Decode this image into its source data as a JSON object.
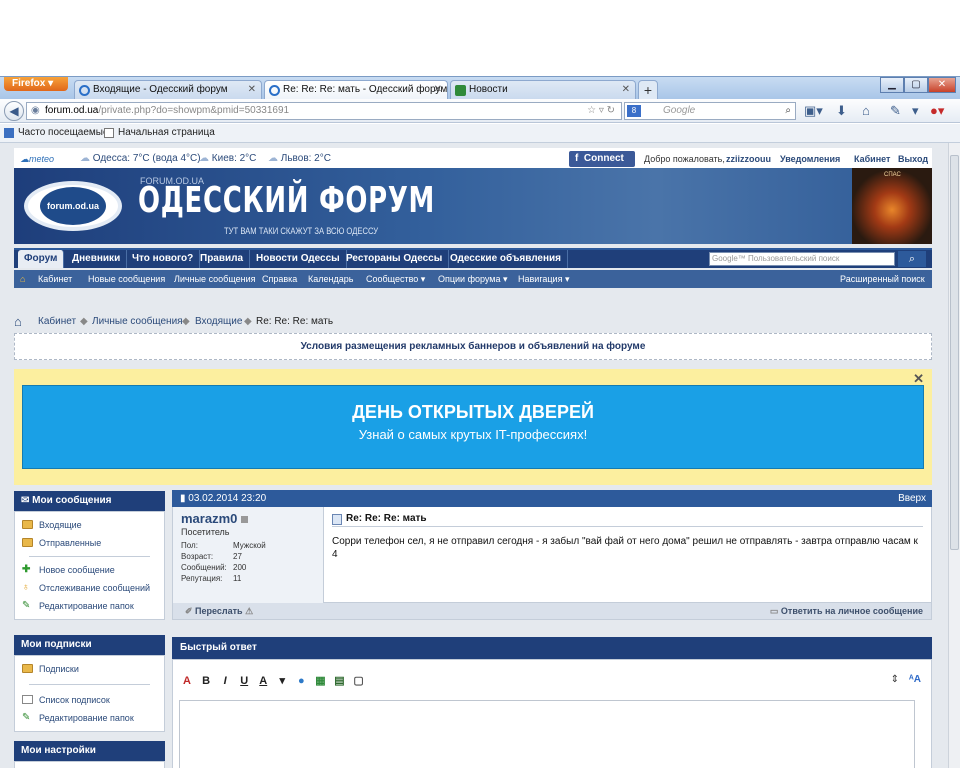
{
  "browser": {
    "app_button": "Firefox",
    "tabs": [
      {
        "title": "Входящие - Одесский форум",
        "active": false
      },
      {
        "title": "Re: Re: Re: мать - Одесский форум",
        "active": true
      },
      {
        "title": "Новости",
        "active": false
      }
    ],
    "new_tab": "+",
    "url_host": "forum.od.ua",
    "url_path": "/private.php?do=showpm&pmid=50331691",
    "search_placeholder": "Google",
    "bookmarks": [
      "Часто посещаемые",
      "Начальная страница"
    ]
  },
  "site": {
    "weather_brand": "meteo",
    "weather": [
      "Одесса: 7°С (вода 4°С)",
      "Киев: 2°С",
      "Львов: 2°С"
    ],
    "fb_connect": "Connect",
    "welcome": "Добро пожаловать,",
    "username": "zziizzoouu",
    "user_links": [
      "Уведомления",
      "Кабинет",
      "Выход"
    ],
    "header_small": "FORUM.OD.UA",
    "logo_text": "forum.od.ua",
    "title": "ОДЕССКИЙ ФОРУМ",
    "tagline": "ТУТ ВАМ ТАКИ СКАЖУТ ЗА ВСЮ ОДЕССУ",
    "art_label": "СПАС",
    "main_nav": [
      "Форум",
      "Дневники",
      "Что нового?",
      "Правила",
      "Новости Одессы",
      "Рестораны Одессы",
      "Одесские объявления"
    ],
    "search_placeholder": "Google™ Пользовательский поиск",
    "sub_nav": [
      "Кабинет",
      "Новые сообщения",
      "Личные сообщения",
      "Справка",
      "Календарь",
      "Сообщество ▾",
      "Опции форума ▾",
      "Навигация ▾"
    ],
    "advanced_search": "Расширенный поиск"
  },
  "breadcrumb": [
    "Кабинет",
    "Личные сообщения",
    "Входящие",
    "Re: Re: Re: мать"
  ],
  "rules_link": "Условия размещения рекламных баннеров и объявлений на форуме",
  "ad": {
    "headline": "ДЕНЬ ОТКРЫТЫХ ДВЕРЕЙ",
    "subline": "Узнай о самых крутых IT-профессиях!",
    "close": "✕"
  },
  "sidebar": {
    "my_messages": {
      "title": "Мои сообщения",
      "items": [
        "Входящие",
        "Отправленные",
        "Новое сообщение",
        "Отслеживание сообщений",
        "Редактирование папок"
      ]
    },
    "my_subscriptions": {
      "title": "Мои подписки",
      "items": [
        "Подписки",
        "Список подписок",
        "Редактирование папок"
      ]
    },
    "my_settings": {
      "title": "Мои настройки"
    }
  },
  "post": {
    "date": "03.02.2014 23:20",
    "top_link": "Вверх",
    "author": "marazm0",
    "role": "Посетитель",
    "info": [
      {
        "label": "Пол:",
        "value": "Мужской"
      },
      {
        "label": "Возраст:",
        "value": "27"
      },
      {
        "label": "Сообщений:",
        "value": "200"
      },
      {
        "label": "Репутация:",
        "value": "11"
      }
    ],
    "title": "Re: Re: Re: мать",
    "text": "Сорри телефон сел, я не отправил сегодня - я забыл \"вай фай от него дома\" решил не отправлять - завтра отправлю часам к 4",
    "forward": "Переслать",
    "reply": "Ответить на личное сообщение"
  },
  "quick_reply": {
    "title": "Быстрый ответ",
    "toolbar": [
      "A",
      "B",
      "I",
      "U",
      "A"
    ]
  }
}
